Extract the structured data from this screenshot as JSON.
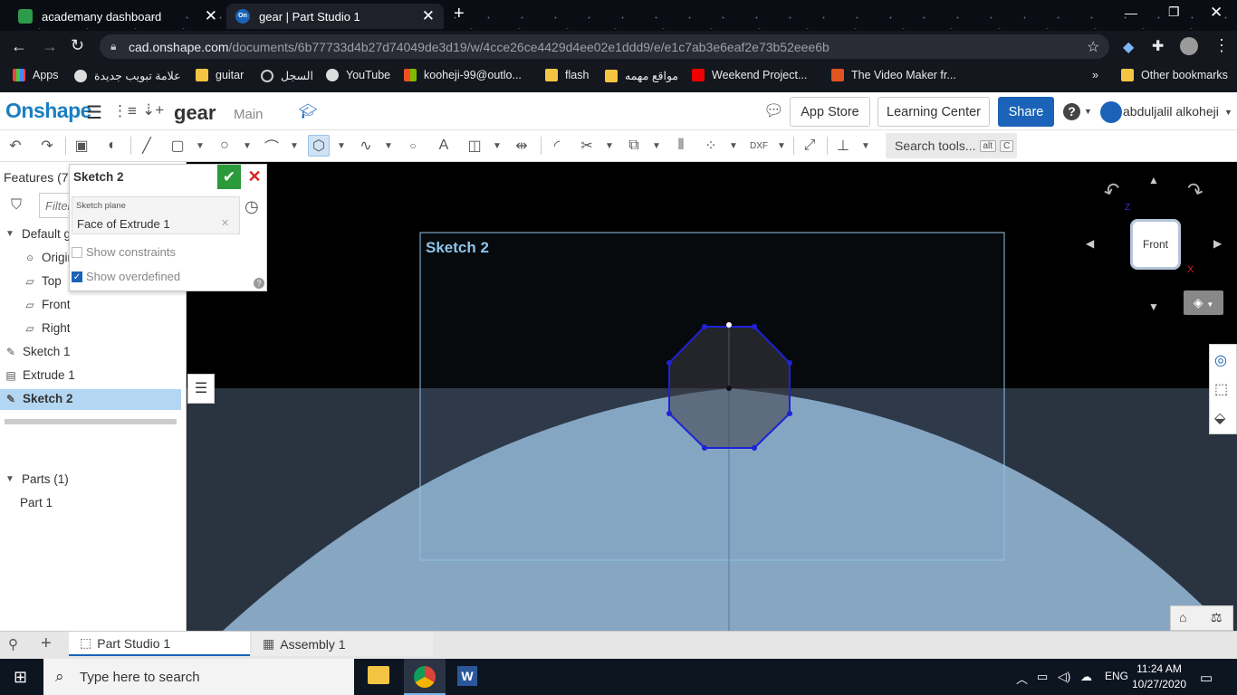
{
  "browser": {
    "tabs": [
      {
        "title": "academany dashboard",
        "close": "✕"
      },
      {
        "title": "gear | Part Studio 1",
        "close": "✕"
      }
    ],
    "new_tab": "+",
    "url_host": "cad.onshape.com",
    "url_path": "/documents/6b77733d4b27d74049de3d19/w/4cce26ce4429d4ee02e1ddd9/e/e1c7ab3e6eaf2e73b52eee6b",
    "bookmarks": [
      {
        "label": "Apps"
      },
      {
        "label": "علامة تبويب جديدة"
      },
      {
        "label": "guitar"
      },
      {
        "label": "السجل"
      },
      {
        "label": "YouTube"
      },
      {
        "label": "kooheji-99@outlo..."
      },
      {
        "label": "flash"
      },
      {
        "label": "مواقع مهمه"
      },
      {
        "label": "Weekend Project..."
      },
      {
        "label": "The Video Maker fr..."
      },
      {
        "label": "»"
      },
      {
        "label": "Other bookmarks"
      }
    ]
  },
  "onshape": {
    "logo": "Onshape",
    "doc_name": "gear",
    "branch": "Main",
    "app_store": "App Store",
    "learning_center": "Learning Center",
    "share": "Share",
    "help": "?",
    "user": "abduljalil alkoheji"
  },
  "toolbar": {
    "search_tools": "Search tools...",
    "kbd_alt": "alt",
    "kbd_c": "C"
  },
  "features": {
    "header": "Features (7)",
    "filter_placeholder": "Filter by name or type",
    "default_geometry": "Default geometry",
    "origin": "Origin",
    "top": "Top",
    "front": "Front",
    "right": "Right",
    "sketch1": "Sketch 1",
    "extrude1": "Extrude 1",
    "sketch2": "Sketch 2",
    "parts_header": "Parts (1)",
    "part1": "Part 1"
  },
  "sketch_dialog": {
    "title": "Sketch 2",
    "plane_label": "Sketch plane",
    "plane_value": "Face of Extrude 1",
    "show_constraints": "Show constraints",
    "show_overdefined": "Show overdefined",
    "show_constraints_checked": false,
    "show_overdefined_checked": true
  },
  "viewport": {
    "sketch_label": "Sketch 2",
    "view_cube_face": "Front",
    "axis_z": "Z",
    "axis_x": "X"
  },
  "bottom_tabs": [
    {
      "label": "Part Studio 1",
      "active": true
    },
    {
      "label": "Assembly 1",
      "active": false
    }
  ],
  "taskbar": {
    "search_placeholder": "Type here to search",
    "lang": "ENG",
    "time": "11:24 AM",
    "date": "10/27/2020"
  },
  "colors": {
    "onshape_blue": "#1a7ec2",
    "sketch_blue": "#1f22d6",
    "selected_row": "#b3d7f2",
    "part_surface": "#86a6c2",
    "ok_green": "#2b9a3a"
  }
}
